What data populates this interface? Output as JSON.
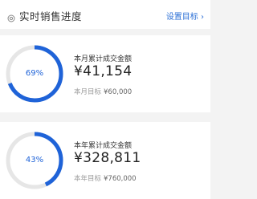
{
  "header": {
    "title": "实时销售进度",
    "settings_link": "设置目标 ›"
  },
  "colors": {
    "accent": "#1f63d8",
    "track": "#e6e6e6",
    "muted": "#999999"
  },
  "cards": [
    {
      "percent_label": "69%",
      "progress": 0.69,
      "label": "本月累计成交金额",
      "amount": "¥41,154",
      "target_label": "本月目标",
      "target_value": "¥60,000"
    },
    {
      "percent_label": "43%",
      "progress": 0.43,
      "label": "本年累计成交金额",
      "amount": "¥328,811",
      "target_label": "本年目标",
      "target_value": "¥760,000"
    }
  ]
}
